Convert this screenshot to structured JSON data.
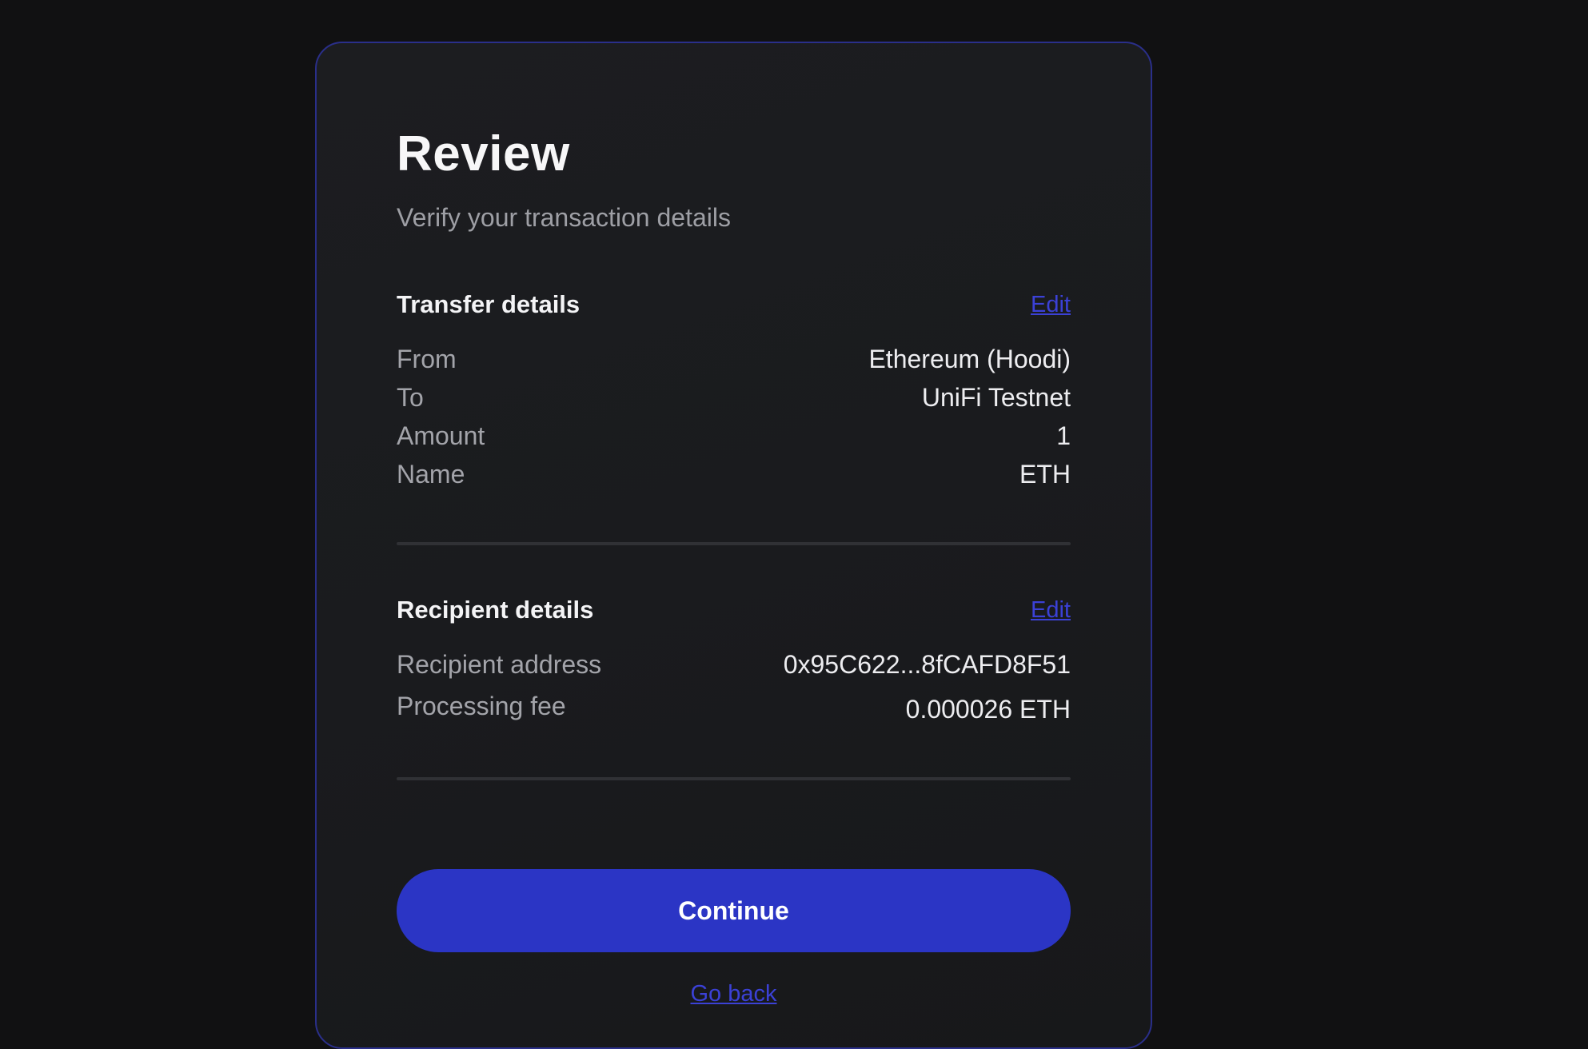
{
  "header": {
    "title": "Review",
    "subtitle": "Verify your transaction details"
  },
  "transfer": {
    "heading": "Transfer details",
    "edit_label": "Edit",
    "rows": [
      {
        "label": "From",
        "value": "Ethereum (Hoodi)"
      },
      {
        "label": "To",
        "value": "UniFi Testnet"
      },
      {
        "label": "Amount",
        "value": "1"
      },
      {
        "label": "Name",
        "value": "ETH"
      }
    ]
  },
  "recipient": {
    "heading": "Recipient details",
    "edit_label": "Edit",
    "rows": [
      {
        "label": "Recipient address",
        "value": "0x95C622...8fCAFD8F51"
      },
      {
        "label": "Processing fee",
        "value": "0.000026 ETH"
      }
    ]
  },
  "actions": {
    "continue_label": "Continue",
    "go_back_label": "Go back"
  },
  "colors": {
    "accent": "#2b35c5",
    "link": "#3b41d6",
    "background": "#111112",
    "card_border": "#2a2f8a"
  }
}
